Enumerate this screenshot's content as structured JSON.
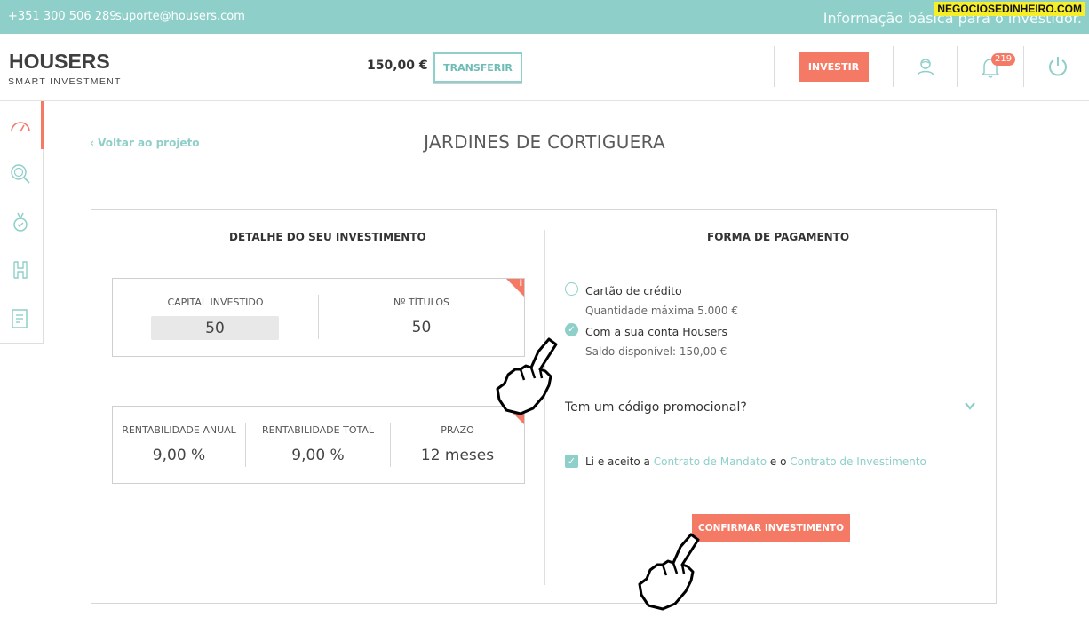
{
  "topbar": {
    "phone": "+351 300 506 289",
    "email": "suporte@housers.com",
    "info": "Informação básica para o investidor.",
    "watermark": "NEGOCIOSEDINHEIRO.COM"
  },
  "header": {
    "logo": "HOUSERS",
    "logo_sub": "SMART INVESTMENT",
    "balance": "150,00 €",
    "transfer_label": "TRANSFERIR",
    "invest_label": "INVESTIR",
    "notifications_count": "219",
    "icons": [
      "user-icon",
      "bell-icon",
      "power-icon"
    ]
  },
  "sidebar": {
    "items": [
      {
        "icon": "dashboard-gauge-icon",
        "active": true
      },
      {
        "icon": "search-projects-icon",
        "active": false
      },
      {
        "icon": "medal-icon",
        "active": false
      },
      {
        "icon": "housers-h-icon",
        "active": false
      },
      {
        "icon": "document-icon",
        "active": false
      }
    ]
  },
  "page": {
    "back_link": "Voltar ao projeto",
    "title": "JARDINES DE CORTIGUERA"
  },
  "investment": {
    "section_title": "DETALHE DO SEU INVESTIMENTO",
    "capital_label": "CAPITAL INVESTIDO",
    "capital_value": "50",
    "titles_label": "Nº TÍTULOS",
    "titles_value": "50",
    "annual_label": "RENTABILIDADE ANUAL",
    "annual_value": "9,00 %",
    "total_label": "RENTABILIDADE TOTAL",
    "total_value": "9,00 %",
    "term_label": "PRAZO",
    "term_value": "12 meses",
    "info_badge": "i"
  },
  "payment": {
    "section_title": "FORMA DE PAGAMENTO",
    "option1_label": "Cartão de crédito",
    "option1_sub": "Quantidade máxima 5.000 €",
    "option2_label": "Com a sua conta Housers",
    "option2_sub": "Saldo disponível: 150,00 €",
    "selected": "option2",
    "promo_label": "Tem um código promocional?",
    "agree_prefix": "Li e aceito a ",
    "agree_link1": "Contrato de Mandato",
    "agree_mid": " e o ",
    "agree_link2": "Contrato de Investimento",
    "agree_checked": true,
    "confirm_label": "CONFIRMAR INVESTIMENTO"
  },
  "colors": {
    "teal": "#8ecfc9",
    "coral": "#f47a66",
    "watermark_bg": "#f7ee2a"
  }
}
